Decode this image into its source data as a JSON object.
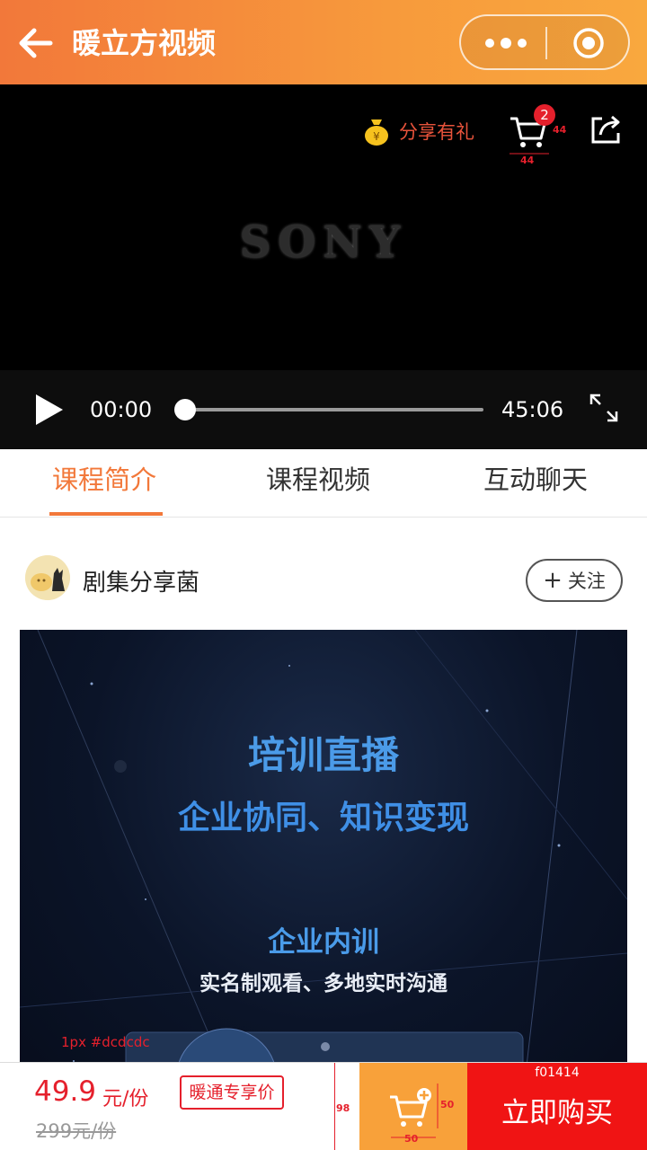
{
  "header": {
    "title": "暖立方视频",
    "back_icon": "arrow-left-icon",
    "more_icon": "more-dots-icon",
    "close_icon": "target-circle-icon",
    "gradient": [
      "#f2783a",
      "#f9a83e"
    ]
  },
  "video": {
    "share_gift_label": "分享有礼",
    "cart_badge": "2",
    "cart_dim_w": "44",
    "cart_dim_h": "44",
    "logo_text": "SONY",
    "current_time": "00:00",
    "total_time": "45:06",
    "progress": 0
  },
  "tabs": [
    {
      "label": "课程简介",
      "active": true
    },
    {
      "label": "课程视频",
      "active": false
    },
    {
      "label": "互动聊天",
      "active": false
    }
  ],
  "author": {
    "name": "剧集分享菌",
    "follow_label": "关注"
  },
  "banner": {
    "title": "培训直播",
    "subtitle": "企业协同、知识变现",
    "line1": "企业内训",
    "line2": "实名制观看、多地实时沟通",
    "border_note": "1px #dcdcdc"
  },
  "bottom_bar": {
    "price": "49.9",
    "price_unit": "元/份",
    "old_price": "299元/份",
    "vip_tag": "暖通专享价",
    "height_note": "98",
    "cart_dim_w": "50",
    "cart_dim_h": "50",
    "buy_color_note": "f01414",
    "buy_label": "立即购买",
    "accent": "#f01414",
    "cart_color": "#f8a13a"
  }
}
